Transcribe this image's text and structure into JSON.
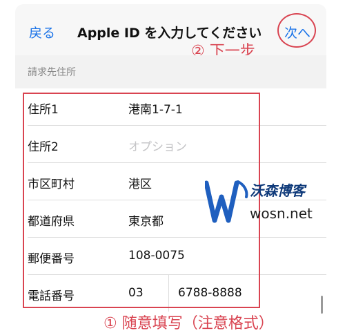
{
  "nav": {
    "back_label": "戻る",
    "title": "Apple ID を入力してください",
    "next_label": "次へ"
  },
  "annotations": {
    "step2": "② 下一步",
    "bottom": "① 随意填写（注意格式）"
  },
  "section": {
    "header": "請求先住所"
  },
  "form": {
    "address1": {
      "label": "住所1",
      "value": "港南1-7-1"
    },
    "address2": {
      "label": "住所2",
      "placeholder": "オプション"
    },
    "city": {
      "label": "市区町村",
      "value": "港区"
    },
    "prefecture": {
      "label": "都道府県",
      "value": "東京都"
    },
    "postal": {
      "label": "郵便番号",
      "value": "108-0075"
    },
    "phone": {
      "label": "電話番号",
      "area_code": "03",
      "number": "6788-8888"
    }
  },
  "watermark": {
    "brand": "沃森博客",
    "url": "wosn.net"
  },
  "colors": {
    "accent": "#1a73e8",
    "annotation": "#d94451",
    "watermark": "#1f5fbf"
  }
}
